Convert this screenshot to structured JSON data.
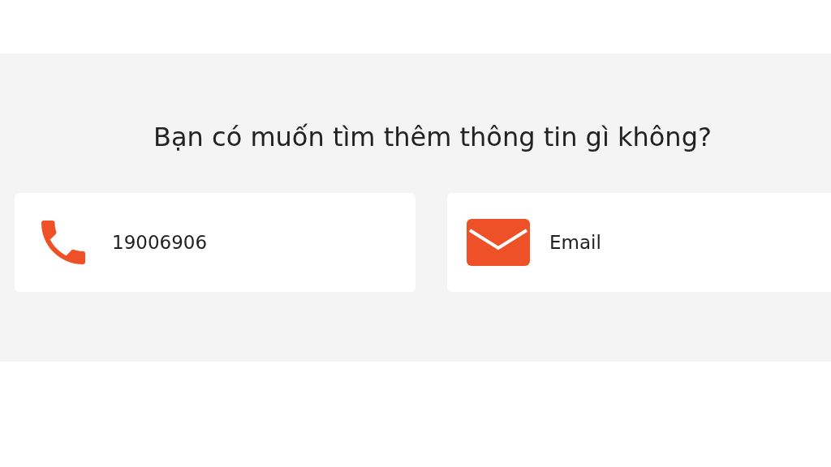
{
  "heading": "Bạn có muốn tìm thêm thông tin gì không?",
  "contacts": [
    {
      "kind": "phone",
      "label": "19006906"
    },
    {
      "kind": "email",
      "label": "Email"
    }
  ]
}
